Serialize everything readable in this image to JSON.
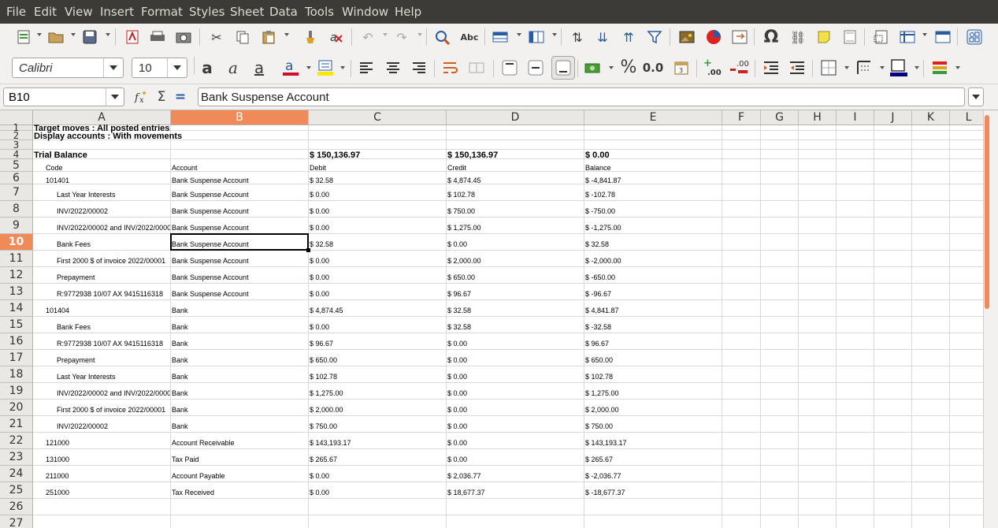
{
  "menu": [
    "File",
    "Edit",
    "View",
    "Insert",
    "Format",
    "Styles",
    "Sheet",
    "Data",
    "Tools",
    "Window",
    "Help"
  ],
  "toolbar": {
    "font_name": "Calibri",
    "font_size": "10",
    "percent_symbol": "%",
    "decimal_format": "0.0",
    "add_decimal_value": ".00",
    "delete_decimal_value": ".00"
  },
  "formula_bar": {
    "name_box": "B10",
    "content": "Bank Suspense Account"
  },
  "columns": [
    "A",
    "B",
    "C",
    "D",
    "E",
    "F",
    "G",
    "H",
    "I",
    "J",
    "K",
    "L"
  ],
  "selected_cell": {
    "column": "B",
    "row": 10
  },
  "sheet": {
    "target_moves": "Target moves :  All posted entries",
    "display_accounts": "Display accounts :  With movements",
    "title": "Trial Balance",
    "total_debit": "$ 150,136.97",
    "total_credit": "$ 150,136.97",
    "total_balance": "$ 0.00",
    "headers": [
      "Code",
      "Account",
      "Debit",
      "Credit",
      "Balance"
    ],
    "rows": [
      {
        "code": "101401",
        "account": "Bank Suspense Account",
        "debit": "$ 32.58",
        "credit": "$ 4,874.45",
        "balance": "$ -4,841.87",
        "indent": 1
      },
      {
        "code": "Last Year Interests",
        "account": "Bank Suspense Account",
        "debit": "$ 0.00",
        "credit": "$ 102.78",
        "balance": "$ -102.78",
        "indent": 2
      },
      {
        "code": "INV/2022/00002",
        "account": "Bank Suspense Account",
        "debit": "$ 0.00",
        "credit": "$ 750.00",
        "balance": "$ -750.00",
        "indent": 2
      },
      {
        "code": "INV/2022/00002 and INV/2022/00001",
        "account": "Bank Suspense Account",
        "debit": "$ 0.00",
        "credit": "$ 1,275.00",
        "balance": "$ -1,275.00",
        "indent": 2
      },
      {
        "code": "Bank Fees",
        "account": "Bank Suspense Account",
        "debit": "$ 32.58",
        "credit": "$ 0.00",
        "balance": "$ 32.58",
        "indent": 2
      },
      {
        "code": "First 2000 $ of invoice 2022/00001",
        "account": "Bank Suspense Account",
        "debit": "$ 0.00",
        "credit": "$ 2,000.00",
        "balance": "$ -2,000.00",
        "indent": 2
      },
      {
        "code": "Prepayment",
        "account": "Bank Suspense Account",
        "debit": "$ 0.00",
        "credit": "$ 650.00",
        "balance": "$ -650.00",
        "indent": 2
      },
      {
        "code": "R:9772938  10/07 AX 9415116318",
        "account": "Bank Suspense Account",
        "debit": "$ 0.00",
        "credit": "$ 96.67",
        "balance": "$ -96.67",
        "indent": 2
      },
      {
        "code": "101404",
        "account": "Bank",
        "debit": "$ 4,874.45",
        "credit": "$ 32.58",
        "balance": "$ 4,841.87",
        "indent": 1
      },
      {
        "code": "Bank Fees",
        "account": "Bank",
        "debit": "$ 0.00",
        "credit": "$ 32.58",
        "balance": "$ -32.58",
        "indent": 2
      },
      {
        "code": "R:9772938  10/07 AX 9415116318",
        "account": "Bank",
        "debit": "$ 96.67",
        "credit": "$ 0.00",
        "balance": "$ 96.67",
        "indent": 2
      },
      {
        "code": "Prepayment",
        "account": "Bank",
        "debit": "$ 650.00",
        "credit": "$ 0.00",
        "balance": "$ 650.00",
        "indent": 2
      },
      {
        "code": "Last Year Interests",
        "account": "Bank",
        "debit": "$ 102.78",
        "credit": "$ 0.00",
        "balance": "$ 102.78",
        "indent": 2
      },
      {
        "code": "INV/2022/00002 and INV/2022/00001",
        "account": "Bank",
        "debit": "$ 1,275.00",
        "credit": "$ 0.00",
        "balance": "$ 1,275.00",
        "indent": 2
      },
      {
        "code": "First 2000 $ of invoice 2022/00001",
        "account": "Bank",
        "debit": "$ 2,000.00",
        "credit": "$ 0.00",
        "balance": "$ 2,000.00",
        "indent": 2
      },
      {
        "code": "INV/2022/00002",
        "account": "Bank",
        "debit": "$ 750.00",
        "credit": "$ 0.00",
        "balance": "$ 750.00",
        "indent": 2
      },
      {
        "code": "121000",
        "account": "Account Receivable",
        "debit": "$ 143,193.17",
        "credit": "$ 0.00",
        "balance": "$ 143,193.17",
        "indent": 1
      },
      {
        "code": "131000",
        "account": "Tax Paid",
        "debit": "$ 265.67",
        "credit": "$ 0.00",
        "balance": "$ 265.67",
        "indent": 1
      },
      {
        "code": "211000",
        "account": "Account Payable",
        "debit": "$ 0.00",
        "credit": "$ 2,036.77",
        "balance": "$ -2,036.77",
        "indent": 1
      },
      {
        "code": "251000",
        "account": "Tax Received",
        "debit": "$ 0.00",
        "credit": "$ 18,677.37",
        "balance": "$ -18,677.37",
        "indent": 1
      }
    ]
  },
  "colors": {
    "menubar_bg": "#3c3b37",
    "menubar_text": "#dfdbd2",
    "selection_accent": "#f08a58",
    "header_bg": "#eae8e4",
    "gridline": "#d9d9d9"
  },
  "icons": {
    "toolbar_row1": [
      "new-document-icon",
      "open-folder-icon",
      "save-icon",
      "export-pdf-icon",
      "print-icon",
      "print-preview-icon",
      "cut-icon",
      "copy-icon",
      "paste-icon",
      "clone-formatting-icon",
      "clear-formatting-icon",
      "undo-icon",
      "redo-icon",
      "find-replace-icon",
      "spellcheck-icon",
      "row-icon",
      "column-icon",
      "sort-icon",
      "sort-ascending-icon",
      "sort-descending-icon",
      "autofilter-icon",
      "insert-image-icon",
      "insert-chart-icon",
      "pivot-table-icon",
      "special-character-icon",
      "hyperlink-icon",
      "comment-icon",
      "header-footer-icon",
      "define-print-area-icon",
      "freeze-rows-columns-icon",
      "split-window-icon",
      "show-draw-functions-icon"
    ],
    "toolbar_row2": [
      "bold-icon",
      "italic-icon",
      "underline-icon",
      "font-color-icon",
      "highlight-color-icon",
      "align-left-icon",
      "align-center-icon",
      "align-right-icon",
      "wrap-text-icon",
      "merge-cells-icon",
      "align-top-icon",
      "align-middle-icon",
      "align-bottom-icon",
      "currency-format-icon",
      "percent-format-icon",
      "number-format-icon",
      "date-format-icon",
      "add-decimal-icon",
      "delete-decimal-icon",
      "increase-indent-icon",
      "decrease-indent-icon",
      "borders-icon",
      "border-style-icon",
      "border-color-icon",
      "conditional-formatting-icon"
    ]
  }
}
